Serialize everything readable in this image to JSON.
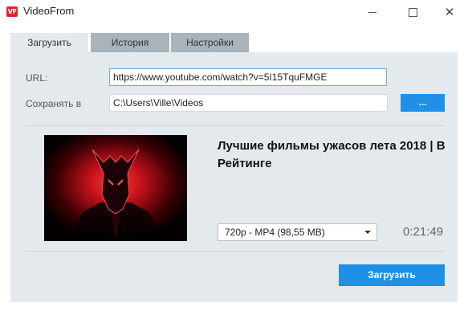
{
  "window": {
    "logo_text": "VF",
    "title": "VideoFrom",
    "minimize_icon": "minimize-icon",
    "maximize_icon": "maximize-icon",
    "close_glyph": "✕"
  },
  "tabs": [
    {
      "label": "Загрузить",
      "active": true
    },
    {
      "label": "История",
      "active": false
    },
    {
      "label": "Настройки",
      "active": false
    }
  ],
  "form": {
    "url_label": "URL:",
    "url_value": "https://www.youtube.com/watch?v=5I15TquFMGE",
    "save_label": "Сохранять в",
    "save_path": "C:\\Users\\Ville\\Videos",
    "browse_label": "..."
  },
  "video": {
    "title": "Лучшие фильмы ужасов лета 2018 | В Рейтинге",
    "quality_selected": "720p - MP4 (98,55 MB)",
    "duration": "0:21:49"
  },
  "download_label": "Загрузить",
  "colors": {
    "accent": "#1e90e6",
    "panel": "#e4e9ed",
    "tab_inactive": "#a9b3bc",
    "logo": "#d9262b"
  }
}
